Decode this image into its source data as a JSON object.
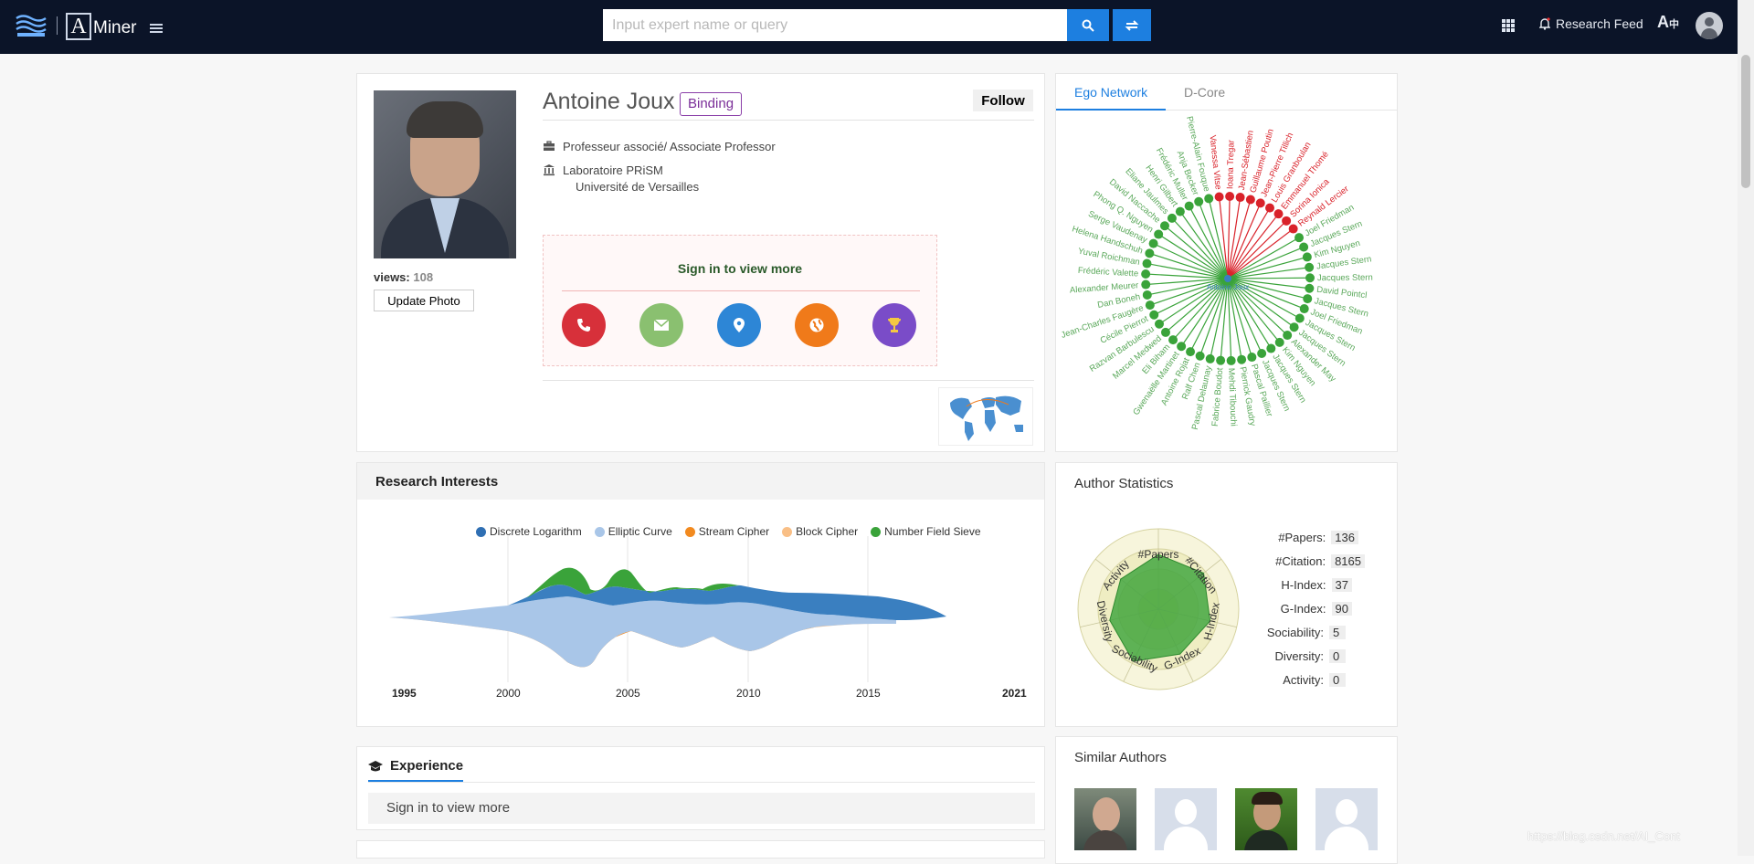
{
  "nav": {
    "brand": "Miner",
    "logo_letter": "A",
    "search_placeholder": "Input expert name or query",
    "research_feed": "Research Feed",
    "lang_icon": "translate-icon"
  },
  "profile": {
    "name": "Antoine Joux",
    "binding": "Binding",
    "follow": "Follow",
    "position": "Professeur associé/ Associate Professor",
    "lab": "Laboratoire PRiSM",
    "university": "Université de Versailles",
    "views_label": "views:",
    "views": "108",
    "update_photo": "Update Photo",
    "signin_text": "Sign in to view more",
    "contact_icons": [
      {
        "name": "phone-icon",
        "color": "#d7303a"
      },
      {
        "name": "email-icon",
        "color": "#8ac070"
      },
      {
        "name": "location-icon",
        "color": "#2d86d6"
      },
      {
        "name": "homepage-icon",
        "color": "#f07a1a"
      },
      {
        "name": "award-icon",
        "color": "#7a4cc8"
      }
    ]
  },
  "ego": {
    "tabs": [
      "Ego Network",
      "D-Core"
    ],
    "center": "Antoine Joux",
    "red_nodes": [
      "Vanessa Vitse",
      "Ioana Tregar",
      "Jean-Sébastien",
      "Guillaume Poutin",
      "Jean-Pierre Tillich",
      "Louis Granboulan",
      "Emmanuel Thomé",
      "Sorina Ionica",
      "Reynald Lercier"
    ],
    "green_nodes": [
      "Joel Friedman",
      "Jacques Stern",
      "Kim Nguyen",
      "Jacques Stern",
      "Jacques Stern",
      "David Pointcl",
      "Jacques Stern",
      "Joel Friedman",
      "Jacques Stern",
      "Jacques Stern",
      "Alexander May",
      "Kim Nguyen",
      "Jacques Stern",
      "Jacques Stern",
      "Pascal Paillier",
      "Pierrick Gaudry",
      "Mehdi Tibouchi",
      "Fabrice Boudot",
      "Pascal Delaunay",
      "Ralf Chen",
      "Antoine Rojat",
      "Gwenaëlle Martinet",
      "Eli Biham",
      "Marcel Medwed",
      "Razvan Barbulescu",
      "Cécile Pierrot",
      "Jean-Charles Faugère",
      "Dan Boneh",
      "Alexander Meurer",
      "Frédéric Valette",
      "Yuval Roichman",
      "Helena Handschuh",
      "Serge Vaudenay",
      "Phong Q. Nguyen",
      "David Naccache",
      "Eliane Jaulmes",
      "Henri Gilbert",
      "Frédéric Muller",
      "Anja Becker",
      "Pierre-Alain Fouque"
    ]
  },
  "research": {
    "title": "Research Interests",
    "legend": [
      {
        "name": "Discrete Logarithm",
        "color": "#2f6fb3"
      },
      {
        "name": "Elliptic Curve",
        "color": "#a9c6e8"
      },
      {
        "name": "Stream Cipher",
        "color": "#f28a1f"
      },
      {
        "name": "Block Cipher",
        "color": "#f9bf86"
      },
      {
        "name": "Number Field Sieve",
        "color": "#3aa33a"
      }
    ],
    "x_labels": [
      "1995",
      "2000",
      "2005",
      "2010",
      "2015",
      "2021"
    ]
  },
  "chart_data": {
    "type": "area",
    "title": "Research Interests",
    "x": [
      1995,
      2000,
      2005,
      2010,
      2015,
      2021
    ],
    "series": [
      {
        "name": "Discrete Logarithm"
      },
      {
        "name": "Elliptic Curve"
      },
      {
        "name": "Stream Cipher"
      },
      {
        "name": "Block Cipher"
      },
      {
        "name": "Number Field Sieve"
      }
    ]
  },
  "stats": {
    "title": "Author Statistics",
    "rows": [
      {
        "label": "#Papers:",
        "value": "136"
      },
      {
        "label": "#Citation:",
        "value": "8165"
      },
      {
        "label": "H-Index:",
        "value": "37"
      },
      {
        "label": "G-Index:",
        "value": "90"
      },
      {
        "label": "Sociability:",
        "value": "5"
      },
      {
        "label": "Diversity:",
        "value": "0"
      },
      {
        "label": "Activity:",
        "value": "0"
      }
    ],
    "radar_axes": [
      "#Papers",
      "#Citation",
      "H-Index",
      "G-Index",
      "Sociability",
      "Diversity",
      "Activity"
    ]
  },
  "experience": {
    "title": "Experience",
    "signin_text": "Sign in to view more"
  },
  "similar": {
    "title": "Similar Authors"
  },
  "watermark": "https://blog.csdn.net/AI_Cont"
}
